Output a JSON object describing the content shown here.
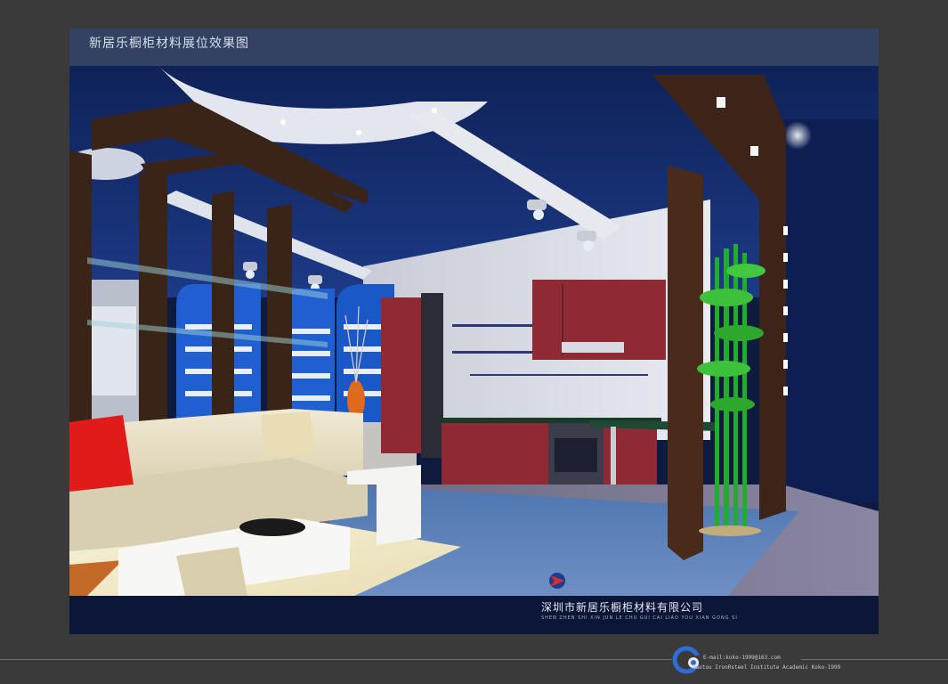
{
  "title": "新居乐橱柜材料展位效果图",
  "company": {
    "name_cn": "深圳市新居乐橱柜材料有限公司",
    "name_pinyin": "SHEN ZHEN SHI XIN JUN LE CHU GUI CAI LIAO YOU XIAN GONG SI"
  },
  "footer": {
    "email": "E-mail:koko-1999@163.com",
    "institute": "Baotou IronRsteel Institute Academic Koko-1999",
    "logo_icon": "cg-logo-icon"
  },
  "colors": {
    "background": "#3a3a3a",
    "ceiling": "#12285e",
    "cabinet_red": "#8e2a33",
    "carpet": "#5b7fb3"
  }
}
